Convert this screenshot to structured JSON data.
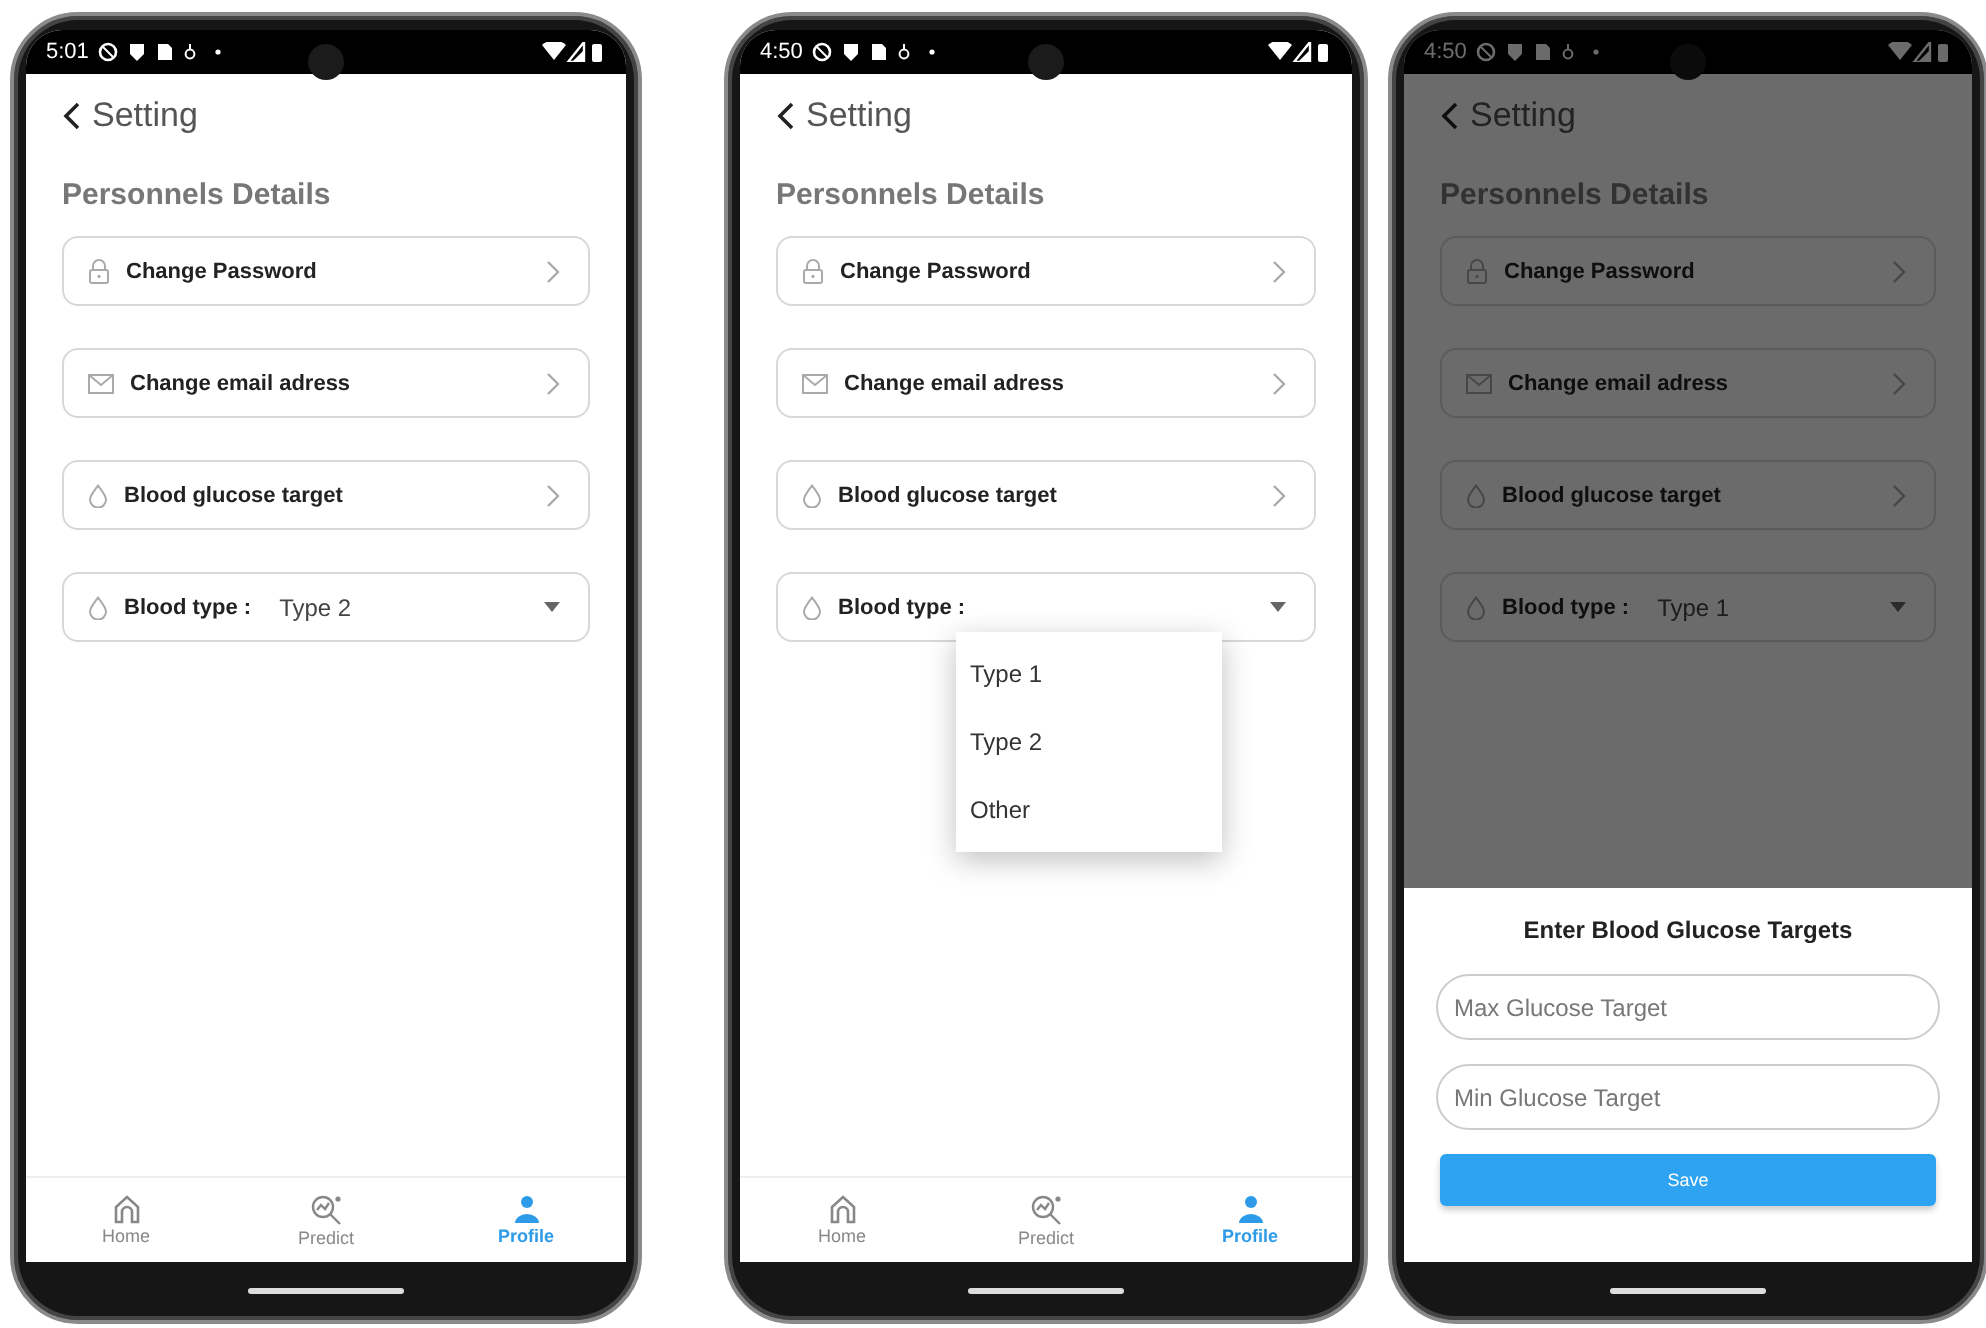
{
  "phones": [
    {
      "status_bar": {
        "time": "5:01"
      },
      "header": {
        "title": "Setting"
      },
      "section_title": "Personnels Details",
      "dimmed": false,
      "rows": [
        {
          "kind": "link",
          "label": "Change Password"
        },
        {
          "kind": "link",
          "label": "Change email adress"
        },
        {
          "kind": "link",
          "label": "Blood glucose target"
        },
        {
          "kind": "select",
          "label": "Blood type :",
          "value": "Type 2"
        }
      ],
      "nav": [
        {
          "label": "Home",
          "selected": false
        },
        {
          "label": "Predict",
          "selected": false
        },
        {
          "label": "Profile",
          "selected": true
        }
      ]
    },
    {
      "status_bar": {
        "time": "4:50"
      },
      "header": {
        "title": "Setting"
      },
      "section_title": "Personnels Details",
      "dimmed": false,
      "rows": [
        {
          "kind": "link",
          "label": "Change Password"
        },
        {
          "kind": "link",
          "label": "Change email adress"
        },
        {
          "kind": "link",
          "label": "Blood glucose target"
        },
        {
          "kind": "select",
          "label": "Blood type :",
          "value": ""
        }
      ],
      "menu": {
        "options": [
          "Type 1",
          "Type 2",
          "Other"
        ]
      },
      "nav": [
        {
          "label": "Home",
          "selected": false
        },
        {
          "label": "Predict",
          "selected": false
        },
        {
          "label": "Profile",
          "selected": true
        }
      ]
    },
    {
      "status_bar": {
        "time": "4:50"
      },
      "header": {
        "title": "Setting"
      },
      "section_title": "Personnels Details",
      "dimmed": true,
      "rows": [
        {
          "kind": "link",
          "label": "Change Password"
        },
        {
          "kind": "link",
          "label": "Change email adress"
        },
        {
          "kind": "link",
          "label": "Blood glucose target"
        },
        {
          "kind": "select",
          "label": "Blood type :",
          "value": "Type 1"
        }
      ],
      "sheet": {
        "title": "Enter Blood Glucose Targets",
        "fields": [
          {
            "placeholder": "Max Glucose Target"
          },
          {
            "placeholder": "Min Glucose Target"
          }
        ],
        "button": "Save"
      }
    }
  ]
}
